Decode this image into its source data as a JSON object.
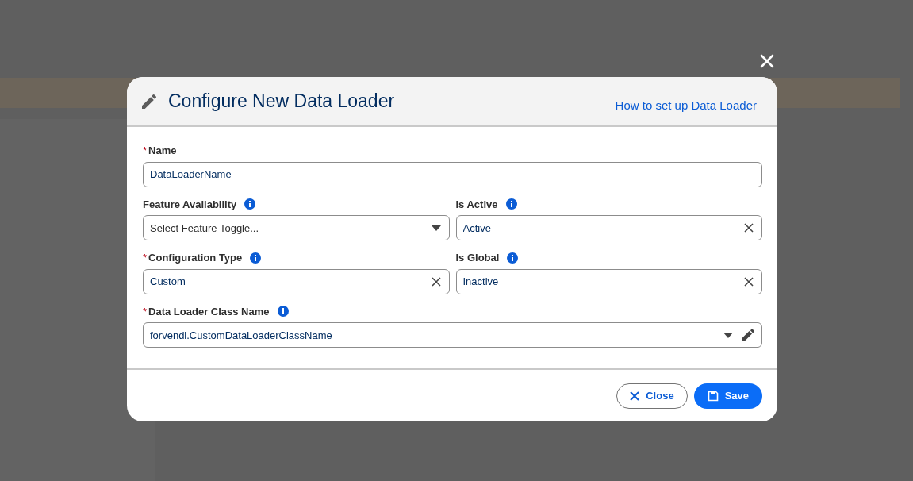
{
  "modal": {
    "title": "Configure New Data Loader",
    "help_link": "How to set up Data Loader",
    "fields": [
      {
        "kind": "text",
        "label": "Name",
        "required_mark": "*",
        "info": false,
        "value": "DataLoaderName"
      },
      {
        "kind": "select",
        "label": "Feature Availability",
        "info": true,
        "placeholder": "Select Feature Toggle..."
      },
      {
        "kind": "clearable",
        "label": "Is Active",
        "info": true,
        "value": "Active"
      },
      {
        "kind": "clearable",
        "label": "Configuration Type",
        "required_mark": "*",
        "info": true,
        "value": "Custom"
      },
      {
        "kind": "clearable",
        "label": "Is Global",
        "info": true,
        "value": "Inactive"
      },
      {
        "kind": "lookup",
        "label": "Data Loader Class Name",
        "required_mark": "*",
        "info": true,
        "value": "forvendi.CustomDataLoaderClassName"
      }
    ],
    "buttons": [
      {
        "kind": "close",
        "label": "Close"
      },
      {
        "kind": "save",
        "label": "Save"
      }
    ]
  }
}
